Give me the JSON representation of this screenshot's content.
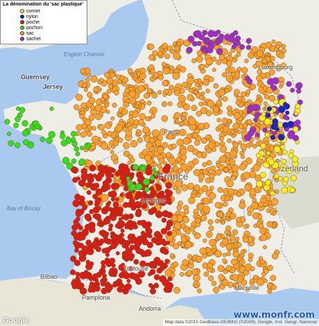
{
  "legend": {
    "title": "La dénomination du 'sac plastique'",
    "items": [
      {
        "label": "cornet",
        "color": "#ffee22"
      },
      {
        "label": "nylon",
        "color": "#1a22c8"
      },
      {
        "label": "poche",
        "color": "#e01b10"
      },
      {
        "label": "pochon",
        "color": "#35e01a"
      },
      {
        "label": "sac",
        "color": "#ffa02a"
      },
      {
        "label": "sachet",
        "color": "#a02ec8"
      }
    ]
  },
  "place_labels": {
    "english_channel": "English Channel",
    "guernsey": "Guernsey",
    "jersey": "Jersey",
    "paris": "Paris",
    "france": "France",
    "limoges": "Limoges",
    "bay_of_biscay": "Bay of Biscay",
    "bilbao": "Bilbao",
    "pamplona": "Pamplona",
    "andorra": "Andorra",
    "zerland": "zerland",
    "luxembourg": "Luxembourg",
    "marseille": "Marseille",
    "toulouse": "Toulouse"
  },
  "attribution": "Map data ©2015 GeoBasis-DE/BKG (©2009), Google, Inst. Geogr. Nacional",
  "google_logo": "Google",
  "watermark": "www.monfr.com"
}
